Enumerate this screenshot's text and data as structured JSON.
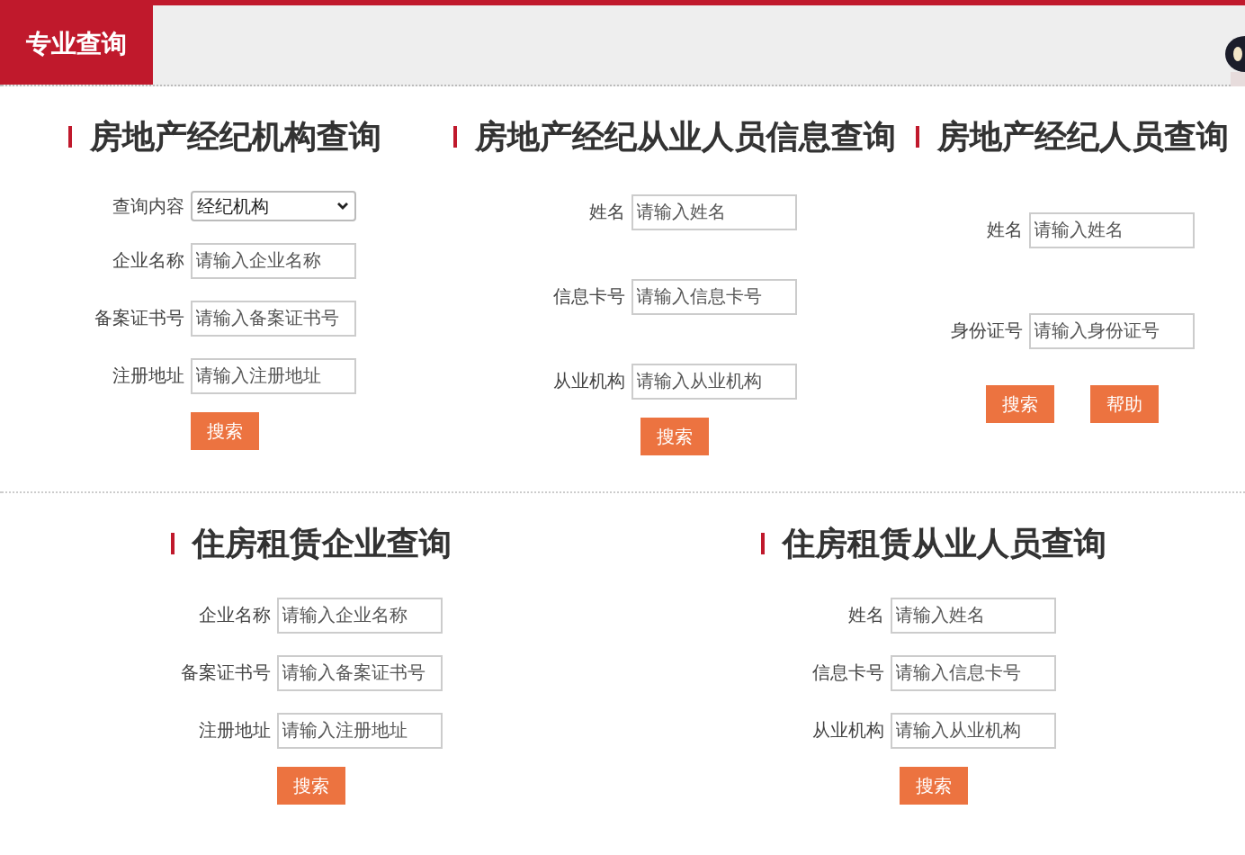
{
  "header": {
    "tab": "专业查询"
  },
  "rows": [
    {
      "sections": [
        {
          "title": "房地产经纪机构查询",
          "fields": [
            {
              "kind": "select",
              "label": "查询内容",
              "value": "经纪机构"
            },
            {
              "kind": "input",
              "label": "企业名称",
              "placeholder": "请输入企业名称"
            },
            {
              "kind": "input",
              "label": "备案证书号",
              "placeholder": "请输入备案证书号"
            },
            {
              "kind": "input",
              "label": "注册地址",
              "placeholder": "请输入注册地址"
            }
          ],
          "buttons": [
            "搜索"
          ]
        },
        {
          "title": "房地产经纪从业人员信息查询",
          "fields": [
            {
              "kind": "input",
              "label": "姓名",
              "placeholder": "请输入姓名"
            },
            {
              "kind": "input",
              "label": "信息卡号",
              "placeholder": "请输入信息卡号"
            },
            {
              "kind": "input",
              "label": "从业机构",
              "placeholder": "请输入从业机构"
            }
          ],
          "buttons": [
            "搜索"
          ]
        },
        {
          "title": "房地产经纪人员查询",
          "fields": [
            {
              "kind": "input",
              "label": "姓名",
              "placeholder": "请输入姓名"
            },
            {
              "kind": "input",
              "label": "身份证号",
              "placeholder": "请输入身份证号"
            }
          ],
          "buttons": [
            "搜索",
            "帮助"
          ]
        }
      ]
    },
    {
      "sections": [
        {
          "title": "住房租赁企业查询",
          "fields": [
            {
              "kind": "input",
              "label": "企业名称",
              "placeholder": "请输入企业名称"
            },
            {
              "kind": "input",
              "label": "备案证书号",
              "placeholder": "请输入备案证书号"
            },
            {
              "kind": "input",
              "label": "注册地址",
              "placeholder": "请输入注册地址"
            }
          ],
          "buttons": [
            "搜索"
          ]
        },
        {
          "title": "住房租赁从业人员查询",
          "fields": [
            {
              "kind": "input",
              "label": "姓名",
              "placeholder": "请输入姓名"
            },
            {
              "kind": "input",
              "label": "信息卡号",
              "placeholder": "请输入信息卡号"
            },
            {
              "kind": "input",
              "label": "从业机构",
              "placeholder": "请输入从业机构"
            }
          ],
          "buttons": [
            "搜索"
          ]
        }
      ]
    }
  ]
}
